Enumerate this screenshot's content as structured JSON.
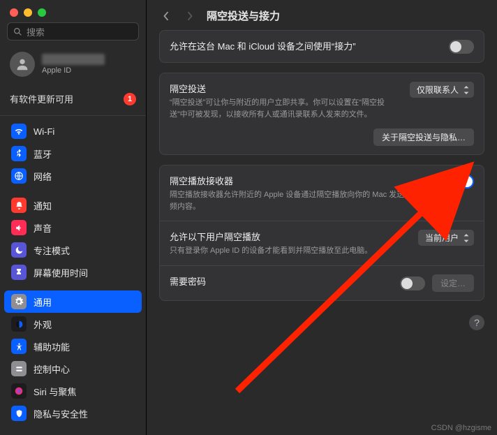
{
  "search": {
    "placeholder": "搜索"
  },
  "account": {
    "sublabel": "Apple ID"
  },
  "update": {
    "label": "有软件更新可用",
    "badge": "1"
  },
  "nav": {
    "group1": [
      {
        "icon": "wifi",
        "bg": "#0a60ff",
        "label": "Wi-Fi"
      },
      {
        "icon": "bluetooth",
        "bg": "#0a60ff",
        "label": "蓝牙"
      },
      {
        "icon": "globe",
        "bg": "#0a60ff",
        "label": "网络"
      }
    ],
    "group2": [
      {
        "icon": "bell",
        "bg": "#ff3b30",
        "label": "通知"
      },
      {
        "icon": "sound",
        "bg": "#ff2d55",
        "label": "声音"
      },
      {
        "icon": "moon",
        "bg": "#5856d6",
        "label": "专注模式"
      },
      {
        "icon": "hourglass",
        "bg": "#5856d6",
        "label": "屏幕使用时间"
      }
    ],
    "group3": [
      {
        "icon": "gear",
        "bg": "#8e8e93",
        "label": "通用",
        "selected": true
      },
      {
        "icon": "appear",
        "bg": "#1c1c1e",
        "label": "外观"
      },
      {
        "icon": "access",
        "bg": "#0a60ff",
        "label": "辅助功能"
      },
      {
        "icon": "control",
        "bg": "#8e8e93",
        "label": "控制中心"
      },
      {
        "icon": "siri",
        "bg": "#1c1c1e",
        "label": "Siri 与聚焦"
      },
      {
        "icon": "hand",
        "bg": "#0a60ff",
        "label": "隐私与安全性"
      }
    ]
  },
  "header": {
    "title": "隔空投送与接力"
  },
  "rows": {
    "handoff": {
      "title": "允许在这台 Mac 和 iCloud 设备之间使用“接力”",
      "toggle": false
    },
    "airdrop": {
      "title": "隔空投送",
      "sub": "“隔空投送”可让你与附近的用户立即共享。你可以设置在“隔空投送”中可被发现，以接收所有人或通讯录联系人发来的文件。",
      "select": "仅限联系人",
      "button": "关于隔空投送与隐私…"
    },
    "airplay": {
      "title": "隔空播放接收器",
      "sub": "隔空播放接收器允许附近的 Apple 设备通过隔空播放向你的 Mac 发送视频和音频内容。",
      "toggle": true
    },
    "allow": {
      "title": "允许以下用户隔空播放",
      "sub": "只有登录你 Apple ID 的设备才能看到并隔空播放至此电脑。",
      "select": "当前用户"
    },
    "password": {
      "title": "需要密码",
      "toggle": false,
      "button": "设定…"
    }
  },
  "help": "?",
  "watermark": "CSDN @hzgisme"
}
